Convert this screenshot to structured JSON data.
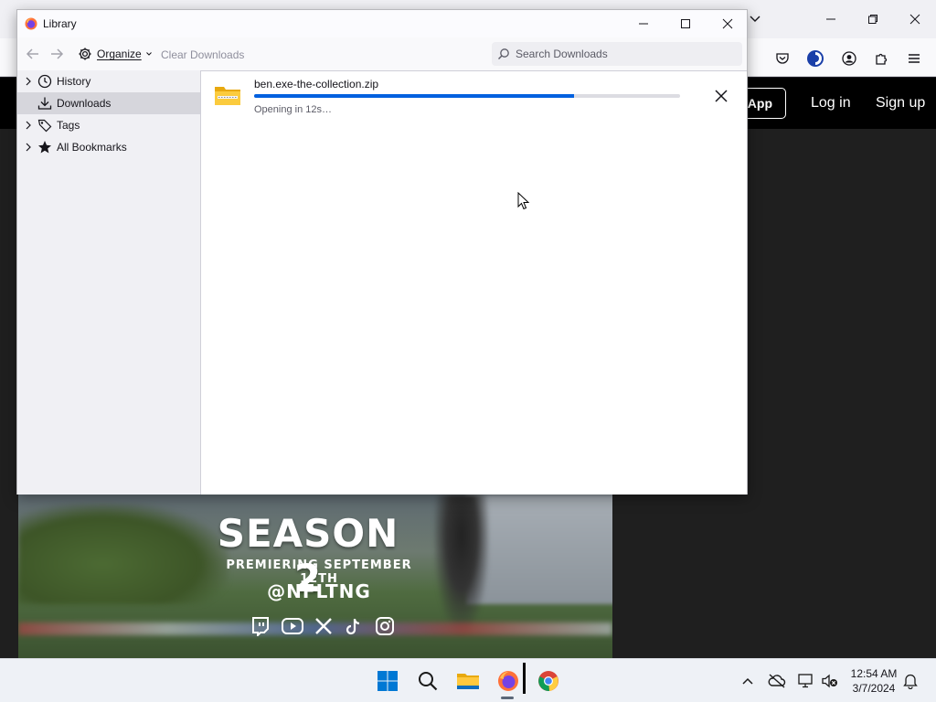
{
  "library": {
    "title": "Library",
    "toolbar": {
      "organize_label": "Organize",
      "clear_label": "Clear Downloads",
      "search_placeholder": "Search Downloads"
    },
    "sidebar": {
      "items": [
        {
          "label": "History",
          "icon": "clock-icon",
          "expandable": true
        },
        {
          "label": "Downloads",
          "icon": "download-icon",
          "expandable": false,
          "selected": true
        },
        {
          "label": "Tags",
          "icon": "tag-icon",
          "expandable": true
        },
        {
          "label": "All Bookmarks",
          "icon": "star-icon",
          "expandable": true
        }
      ]
    },
    "download": {
      "filename": "ben.exe-the-collection.zip",
      "status": "Opening in 12s…",
      "progress": 0.75,
      "icon": "zip-folder-icon"
    }
  },
  "site": {
    "app_button": "App",
    "login_label": "Log in",
    "signup_label": "Sign up"
  },
  "promo": {
    "title": "SEASON 2",
    "subtitle": "PREMIERING SEPTEMBER 12TH",
    "handle": "@NFLTNG",
    "socials": [
      "twitch-icon",
      "youtube-icon",
      "x-icon",
      "tiktok-icon",
      "instagram-icon"
    ]
  },
  "taskbar": {
    "apps": [
      "windows-start-icon",
      "search-icon",
      "file-explorer-icon",
      "firefox-icon",
      "chrome-icon"
    ],
    "time": "12:54 AM",
    "date": "3/7/2024"
  },
  "colors": {
    "accent": "#0060df",
    "site_header": "#000000",
    "sidebar_bg": "#f0f0f4",
    "sidebar_selected": "#d6d6dc"
  }
}
